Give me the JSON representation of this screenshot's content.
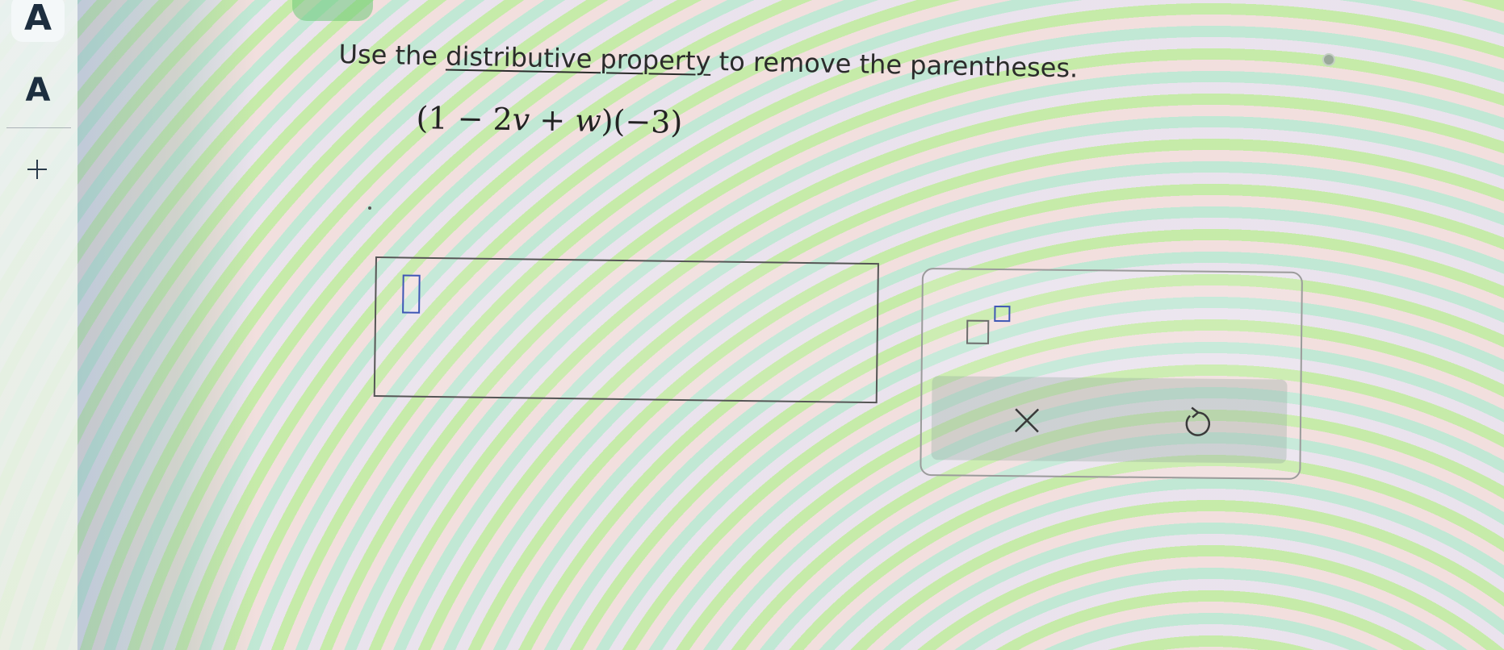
{
  "toolbar": {
    "large_text_label": "A",
    "small_text_label": "A",
    "icons": [
      "plus-icon"
    ]
  },
  "question": {
    "prefix": "Use the ",
    "link_text": "distributive property",
    "suffix": " to remove the parentheses."
  },
  "expression": {
    "open1": "(1 − 2",
    "var_v": "v",
    "plus": " + ",
    "var_w": "w",
    "close1": ")",
    "factor": "(−3)"
  },
  "keypad": {
    "icons": [
      "exponent-template-icon",
      "close-icon",
      "undo-icon"
    ]
  },
  "colors": {
    "accent_blue": "#3e56b6",
    "text_dark": "#2b2b2b",
    "border_gray": "#9b9b9b"
  }
}
